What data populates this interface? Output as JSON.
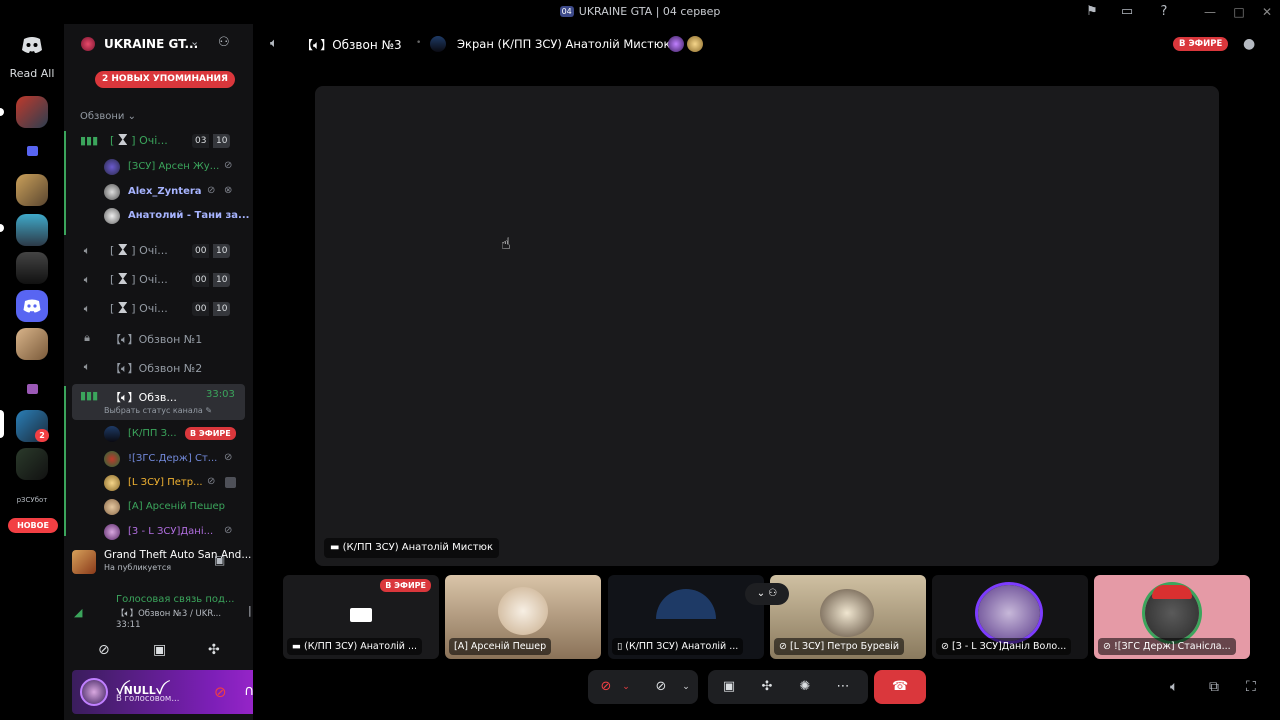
{
  "window": {
    "title": "UKRAINE GTA | 04 сервер",
    "badge": "04"
  },
  "rail": {
    "read_all_label": "Read All",
    "ping_count": "2",
    "text_server_label": "рЗСУбот",
    "new_label": "НОВОЕ"
  },
  "server": {
    "name": "UKRAINE GT...",
    "mentions_label": "2 НОВЫХ УПОМИНАНИЯ",
    "category": "Обзвони"
  },
  "channels": [
    {
      "name": "Очі...",
      "count_a": "03",
      "count_b": "10"
    },
    {
      "name": "Очі...",
      "count_a": "00",
      "count_b": "10"
    },
    {
      "name": "Очі...",
      "count_a": "00",
      "count_b": "10"
    },
    {
      "name": "Очі...",
      "count_a": "00",
      "count_b": "10"
    },
    {
      "name": "Обзвон №1"
    },
    {
      "name": "Обзвон №2"
    },
    {
      "name": "Обзв...",
      "timer": "33:03",
      "status": "Выбрать статус канала"
    }
  ],
  "members_ch1": [
    {
      "name": "[ЗСУ] Арсен Жу...",
      "color": "#3ba55c"
    },
    {
      "name": "Alex_Zyntera",
      "color": "#a7b4ff"
    },
    {
      "name": "Анатолий - Тани за...",
      "color": "#a7b4ff"
    }
  ],
  "members_active": [
    {
      "name": "[К/ПП З...",
      "color": "#3ba55c",
      "live": "В ЭФИРЕ"
    },
    {
      "name": "![ЗГС.Держ] Ст...",
      "color": "#5865f2"
    },
    {
      "name": "[L ЗСУ] Петр...",
      "color": "#f0b232"
    },
    {
      "name": "[A] Арсеній Пешер",
      "color": "#3ba55c"
    },
    {
      "name": "[3 - L ЗСУ]Дані...",
      "color": "#b16ee0"
    }
  ],
  "activity": {
    "game": "Grand Theft Auto San And...",
    "status": "На публикуется"
  },
  "voice": {
    "title": "Голосовая связь под...",
    "channel": "Обзвон №3 / UKR...",
    "time": "33:11"
  },
  "user": {
    "name": "ꪜNULLꪜ",
    "status": "В голосовом..."
  },
  "main_header": {
    "channel": "Обзвон №3",
    "screen_label": "Экран (К/ПП ЗСУ) Анатолій Мистюк",
    "live_label": "В ЭФИРЕ"
  },
  "stage": {
    "label": "(К/ПП ЗСУ) Анатолій Мистюк"
  },
  "tiles": [
    {
      "label": "(К/ПП ЗСУ) Анатолій ...",
      "live": "В ЭФИРЕ",
      "bg": "#1a1a1c"
    },
    {
      "label": "[A] Арсеній Пешер",
      "bg": "#c9b49a"
    },
    {
      "label": "(К/ПП ЗСУ) Анатолій ...",
      "bg": "#1f2a3a"
    },
    {
      "label": "[L ЗСУ] Петро Буревій",
      "bg": "#b9a98d"
    },
    {
      "label": "[З - L ЗСУ]Даніл Воло...",
      "bg": "#1a1a1c"
    },
    {
      "label": "![ЗГС Держ] Станісла...",
      "bg": "#e59aa6"
    }
  ]
}
